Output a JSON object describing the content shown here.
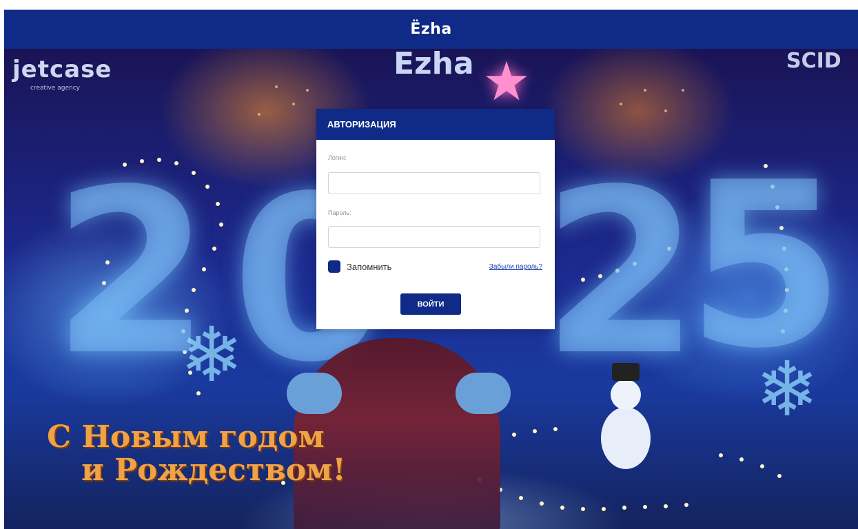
{
  "header": {
    "brand": "Ëzha"
  },
  "background": {
    "logo_left": "jetcase",
    "logo_left_sub": "creative agency",
    "logo_center": "Ezha",
    "logo_right": "SCID",
    "year_digits": [
      "2",
      "0",
      "2",
      "5"
    ],
    "greeting_line1": "С Новым годом",
    "greeting_line2": "и Рождеством!"
  },
  "login": {
    "title": "АВТОРИЗАЦИЯ",
    "login_label": "Логин:",
    "login_value": "",
    "password_label": "Пароль:",
    "password_value": "",
    "remember_label": "Запомнить",
    "remember_checked": true,
    "forgot_link": "Забыли пароль?",
    "submit_label": "ВОЙТИ"
  },
  "colors": {
    "primary": "#0f2a87",
    "link": "#1a3fb0"
  }
}
